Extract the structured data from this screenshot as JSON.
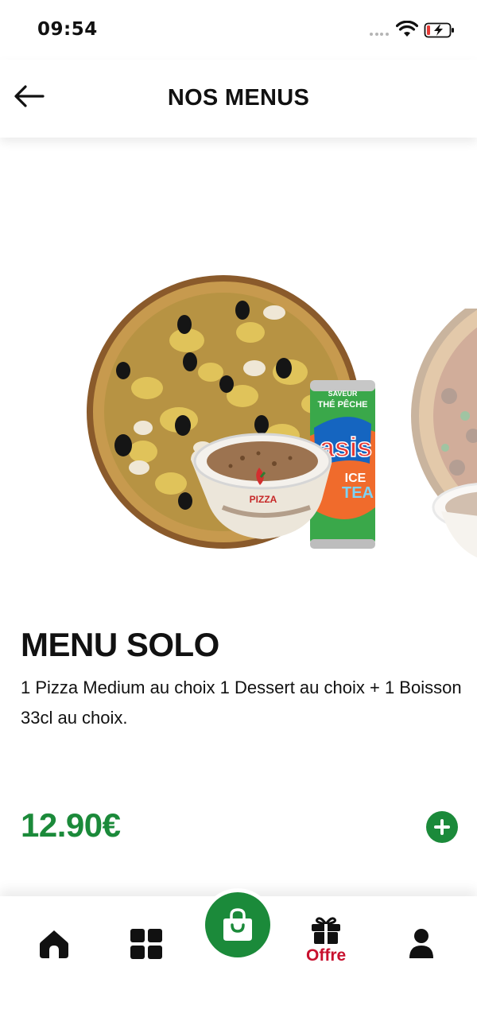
{
  "status_bar": {
    "time": "09:54"
  },
  "header": {
    "title": "NOS MENUS"
  },
  "carousel": {
    "slides": [
      {
        "can_brand": "asis",
        "can_flavor_line1": "SAVEUR",
        "can_flavor_line2": "THÉ PÊCHE",
        "can_ice": "ICE",
        "can_tea": "TEA",
        "cup_label": "PIZZA"
      }
    ]
  },
  "product": {
    "name": "MENU SOLO",
    "description": "1 Pizza Medium au choix 1 Dessert au choix + 1 Boisson 33cl au choix.",
    "price": "12.90€"
  },
  "bottom_nav": {
    "offer_label": "Offre"
  },
  "colors": {
    "accent_green": "#1b8a3a",
    "offer_red": "#c8102e"
  }
}
